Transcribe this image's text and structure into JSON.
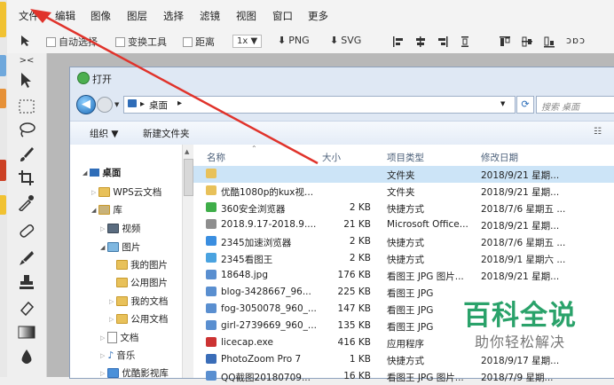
{
  "menu": [
    "文件",
    "编辑",
    "图像",
    "图层",
    "选择",
    "滤镜",
    "视图",
    "窗口",
    "更多"
  ],
  "options": {
    "auto_select": "自动选择",
    "transform": "变换工具",
    "distance": "距离",
    "zoom": "1x ▼",
    "png": "PNG",
    "svg": "SVG",
    "extra": "ɔɒɔ"
  },
  "explorer": {
    "title": "打开",
    "address": "桌面",
    "search_placeholder": "搜索 桌面",
    "organize": "组织 ▼",
    "new_folder": "新建文件夹",
    "columns": [
      "名称",
      "大小",
      "项目类型",
      "修改日期"
    ],
    "nav": [
      "桌面",
      "WPS云文档",
      "库",
      "视频",
      "图片",
      "我的图片",
      "公用图片",
      "我的文档",
      "公用文档",
      "文档",
      "音乐",
      "优酷影视库"
    ],
    "files": [
      {
        "name": "",
        "size": "",
        "type": "文件夹",
        "date": "2018/9/21 星期..."
      },
      {
        "name": "优酷1080p的kux视...",
        "size": "",
        "type": "文件夹",
        "date": "2018/9/21 星期..."
      },
      {
        "name": "360安全浏览器",
        "size": "2 KB",
        "type": "快捷方式",
        "date": "2018/7/6 星期五 ..."
      },
      {
        "name": "2018.9.17-2018.9....",
        "size": "21 KB",
        "type": "Microsoft Office...",
        "date": "2018/9/21 星期..."
      },
      {
        "name": "2345加速浏览器",
        "size": "2 KB",
        "type": "快捷方式",
        "date": "2018/7/6 星期五 ..."
      },
      {
        "name": "2345看图王",
        "size": "2 KB",
        "type": "快捷方式",
        "date": "2018/9/1 星期六 ..."
      },
      {
        "name": "18648.jpg",
        "size": "176 KB",
        "type": "看图王 JPG 图片...",
        "date": "2018/9/21 星期..."
      },
      {
        "name": "blog-3428667_96...",
        "size": "225 KB",
        "type": "看图王 JPG",
        "date": ""
      },
      {
        "name": "fog-3050078_960_...",
        "size": "147 KB",
        "type": "看图王 JPG",
        "date": ""
      },
      {
        "name": "girl-2739669_960_...",
        "size": "135 KB",
        "type": "看图王 JPG",
        "date": ""
      },
      {
        "name": "licecap.exe",
        "size": "416 KB",
        "type": "应用程序",
        "date": ""
      },
      {
        "name": "PhotoZoom Pro 7",
        "size": "1 KB",
        "type": "快捷方式",
        "date": "2018/9/17 星期..."
      },
      {
        "name": "QQ截图20180709...",
        "size": "16 KB",
        "type": "看图王 JPG 图片...",
        "date": "2018/7/9 星期..."
      }
    ]
  },
  "watermark": {
    "title": "百科全说",
    "subtitle": "助你轻松解决"
  },
  "colors": {
    "arrow": "#e0332b",
    "selection": "#cce4f7",
    "watermark_green": "#2aa26a"
  }
}
